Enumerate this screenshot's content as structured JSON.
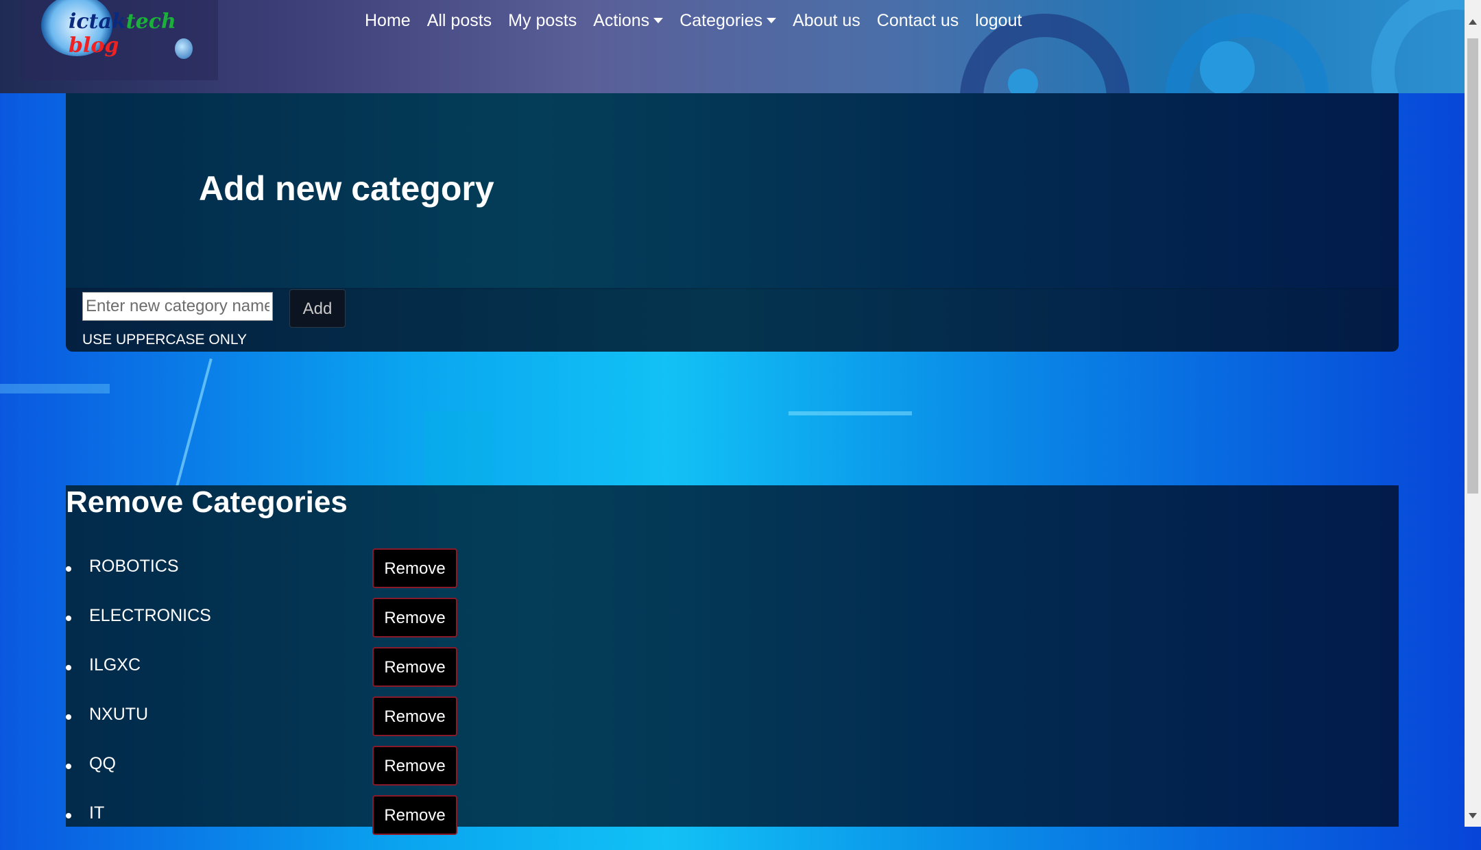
{
  "header": {
    "logo_text": "ictaktech blog",
    "nav": [
      {
        "label": "Home",
        "dropdown": false
      },
      {
        "label": "All posts",
        "dropdown": false
      },
      {
        "label": "My posts",
        "dropdown": false
      },
      {
        "label": "Actions",
        "dropdown": true
      },
      {
        "label": "Categories",
        "dropdown": true
      },
      {
        "label": "About us",
        "dropdown": false
      },
      {
        "label": "Contact us",
        "dropdown": false
      },
      {
        "label": "logout",
        "dropdown": false
      }
    ]
  },
  "add_section": {
    "title": "Add new category",
    "input_placeholder": "Enter new category name",
    "input_value": "",
    "add_label": "Add",
    "hint": "USE UPPERCASE ONLY"
  },
  "remove_section": {
    "title": "Remove Categories",
    "button_label": "Remove",
    "categories": [
      "ROBOTICS",
      "ELECTRONICS",
      "ILGXC",
      "NXUTU",
      "QQ",
      "IT"
    ]
  },
  "colors": {
    "page_background": "#0a9ff0",
    "panel": "#032c4a",
    "remove_button_border": "#8a1a2a"
  }
}
